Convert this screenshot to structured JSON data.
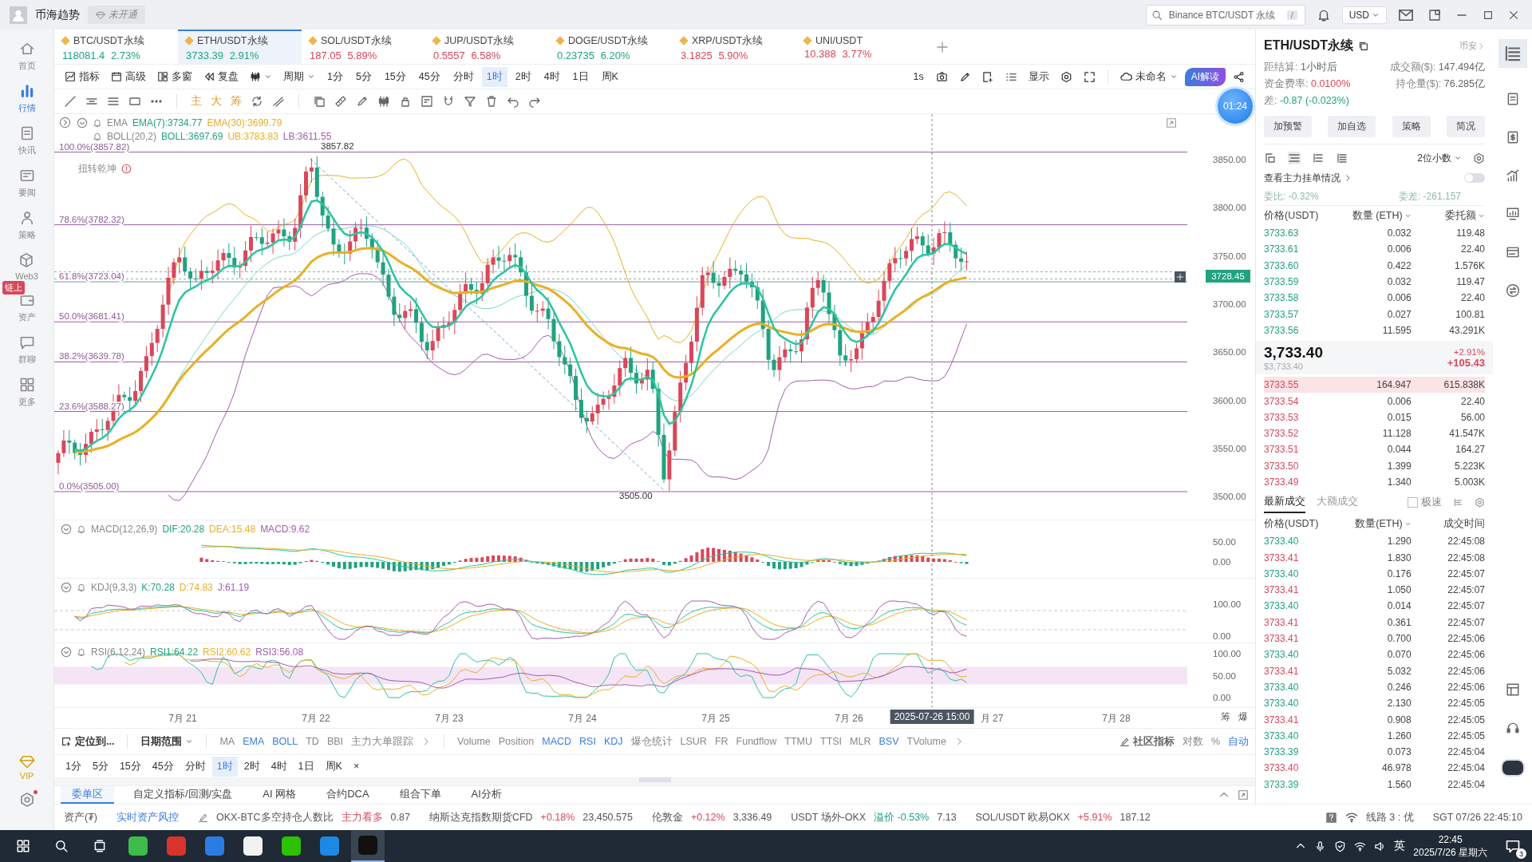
{
  "app_bar": {
    "title": "币海趋势",
    "badge": "未开通",
    "search": {
      "placeholder": "Binance BTC/USDT 永续",
      "shortcut": "/"
    },
    "currency": "USD"
  },
  "sidebar": {
    "items": [
      {
        "label": "首页",
        "selected": false
      },
      {
        "label": "行情",
        "selected": true
      },
      {
        "label": "快讯",
        "selected": false
      },
      {
        "label": "要闻",
        "selected": false
      },
      {
        "label": "策略",
        "selected": false
      },
      {
        "label": "Web3",
        "selected": false
      },
      {
        "label": "资产",
        "selected": false,
        "badge": "链上"
      },
      {
        "label": "群聊",
        "selected": false
      },
      {
        "label": "更多",
        "selected": false
      }
    ],
    "vip": "VIP"
  },
  "tickers": [
    {
      "symbol": "BTC/USDT永续",
      "price": "118081.4",
      "change": "2.73%",
      "color": "#20a27f",
      "selected": false
    },
    {
      "symbol": "ETH/USDT永续",
      "price": "3733.39",
      "change": "2.91%",
      "color": "#20a27f",
      "selected": true
    },
    {
      "symbol": "SOL/USDT永续",
      "price": "187.05",
      "change": "5.89%",
      "color": "#d9475a",
      "selected": false
    },
    {
      "symbol": "JUP/USDT永续",
      "price": "0.5557",
      "change": "6.58%",
      "color": "#d9475a",
      "selected": false
    },
    {
      "symbol": "DOGE/USDT永续",
      "price": "0.23735",
      "change": "6.20%",
      "color": "#20a27f",
      "selected": false
    },
    {
      "symbol": "XRP/USDT永续",
      "price": "3.1825",
      "change": "5.90%",
      "color": "#d9475a",
      "selected": false
    },
    {
      "symbol": "UNI/USDT",
      "price": "10.388",
      "change": "3.77%",
      "color": "#d9475a",
      "selected": false
    }
  ],
  "toolbar": {
    "tools": [
      "指标",
      "高级",
      "多窗",
      "复盘"
    ],
    "period_menu": "周期",
    "periods": [
      {
        "label": "1分",
        "selected": false
      },
      {
        "label": "5分",
        "selected": false
      },
      {
        "label": "15分",
        "selected": false
      },
      {
        "label": "45分",
        "selected": false
      },
      {
        "label": "分时",
        "selected": false
      },
      {
        "label": "1时",
        "selected": true
      },
      {
        "label": "2时",
        "selected": false
      },
      {
        "label": "4时",
        "selected": false
      },
      {
        "label": "1日",
        "selected": false
      },
      {
        "label": "周K",
        "selected": false
      }
    ],
    "interval": "1s",
    "display": "显示",
    "layout": "未命名",
    "ai": "AI解读"
  },
  "drawing_toolbar": {
    "text_tools": [
      "主",
      "大",
      "筹"
    ]
  },
  "chart": {
    "legend": {
      "ema": [
        "EMA",
        "EMA(7):3734.77",
        "EMA(30):3699.79"
      ],
      "boll": [
        "BOLL(20,2)",
        "BOLL:3697.69",
        "UB:3783.83",
        "LB:3611.55"
      ],
      "strategy": "扭转乾坤"
    },
    "fib_levels": [
      "100.0%(3857.82)",
      "78.6%(3782.32)",
      "61.8%(3723.04)",
      "50.0%(3681.41)",
      "38.2%(3639.78)",
      "23.6%(3588.27)",
      "0.0%(3505.00)"
    ],
    "high_marker": "3857.82",
    "low_marker": "3505.00",
    "price_ticks": [
      "3850.00",
      "3800.00",
      "3750.00",
      "3700.00",
      "3650.00",
      "3600.00",
      "3550.00",
      "3500.00"
    ],
    "price_tag": "3728.45",
    "macd": {
      "legend": [
        "MACD(12,26,9)",
        "DIF:20.28",
        "DEA:15.48",
        "MACD:9.62"
      ],
      "ticks": [
        "50.00",
        "0.00"
      ]
    },
    "kdj": {
      "legend": [
        "KDJ(9,3,3)",
        "K:70.28",
        "D:74.83",
        "J:61.19"
      ],
      "ticks": [
        "100.00",
        "0.00"
      ]
    },
    "rsi": {
      "legend": [
        "RSI(6,12,24)",
        "RSI1:64.22",
        "RSI2:60.62",
        "RSI3:56.08"
      ],
      "ticks": [
        "100.00",
        "50.00",
        "0.00"
      ]
    },
    "dates": [
      "7月 21",
      "7月 22",
      "7月 23",
      "7月 24",
      "7月 25",
      "7月 26",
      "月 27",
      "7月 28"
    ],
    "crosshair_time": "2025-07-26 15:00",
    "axis_tools": [
      "筹",
      "爆"
    ]
  },
  "indicator_bar": {
    "locate": "定位到...",
    "date_range": "日期范围",
    "main": [
      {
        "label": "MA",
        "on": false
      },
      {
        "label": "EMA",
        "on": true
      },
      {
        "label": "BOLL",
        "on": true
      },
      {
        "label": "TD",
        "on": false
      },
      {
        "label": "BBI",
        "on": false
      },
      {
        "label": "主力大单跟踪",
        "on": false
      }
    ],
    "sub": [
      {
        "label": "Volume",
        "on": false
      },
      {
        "label": "Position",
        "on": false
      },
      {
        "label": "MACD",
        "on": true
      },
      {
        "label": "RSI",
        "on": true
      },
      {
        "label": "KDJ",
        "on": true
      },
      {
        "label": "爆仓统计",
        "on": false
      },
      {
        "label": "LSUR",
        "on": false
      },
      {
        "label": "FR",
        "on": false
      },
      {
        "label": "Fundflow",
        "on": false
      },
      {
        "label": "TTMU",
        "on": false
      },
      {
        "label": "TTSI",
        "on": false
      },
      {
        "label": "MLR",
        "on": false
      },
      {
        "label": "BSV",
        "on": true
      },
      {
        "label": "TVolume",
        "on": false
      }
    ],
    "community": "社区指标",
    "scales": [
      {
        "label": "对数",
        "on": false
      },
      {
        "label": "%",
        "on": false
      },
      {
        "label": "自动",
        "on": true
      }
    ]
  },
  "period_bar": {
    "periods": [
      {
        "label": "1分",
        "selected": false
      },
      {
        "label": "5分",
        "selected": false
      },
      {
        "label": "15分",
        "selected": false
      },
      {
        "label": "45分",
        "selected": false
      },
      {
        "label": "分时",
        "selected": false
      },
      {
        "label": "1时",
        "selected": true
      },
      {
        "label": "2时",
        "selected": false
      },
      {
        "label": "4时",
        "selected": false
      },
      {
        "label": "1日",
        "selected": false
      },
      {
        "label": "周K",
        "selected": false
      }
    ],
    "close": "×"
  },
  "order_tabs": [
    {
      "label": "委单区",
      "selected": true
    },
    {
      "label": "自定义指标/回测/实盘",
      "selected": false
    },
    {
      "label": "AI 网格",
      "selected": false
    },
    {
      "label": "合约DCA",
      "selected": false
    },
    {
      "label": "组合下单",
      "selected": false
    },
    {
      "label": "AI分析",
      "selected": false
    }
  ],
  "status_bar": {
    "asset": "资产(₮)",
    "risk": "实时资产风控",
    "segments": [
      {
        "text": "OKX-BTC多空持仓人数比",
        "color": "#555555"
      },
      {
        "text": "主力看多",
        "color": "#d9475a"
      },
      {
        "text": "0.87",
        "color": "#555555"
      },
      {
        "text": "纳斯达克指数期货CFD",
        "color": "#555555"
      },
      {
        "text": "+0.18%",
        "color": "#d9475a"
      },
      {
        "text": "23,450.575",
        "color": "#555555"
      },
      {
        "text": "伦敦金",
        "color": "#555555"
      },
      {
        "text": "+0.12%",
        "color": "#d9475a"
      },
      {
        "text": "3,336.49",
        "color": "#555555"
      },
      {
        "text": "USDT 场外-OKX",
        "color": "#555555"
      },
      {
        "text": "溢价 -0.53%",
        "color": "#20a27f"
      },
      {
        "text": "7.13",
        "color": "#555555"
      },
      {
        "text": "SOL/USDT 欧易OKX",
        "color": "#555555"
      },
      {
        "text": "+5.91%",
        "color": "#d9475a"
      },
      {
        "text": "187.12",
        "color": "#555555"
      }
    ],
    "line": "线路 3 : 优",
    "clock": "SGT 07/26 22:45:10"
  },
  "market_panel": {
    "symbol": "ETH/USDT永续",
    "exchange": "币安",
    "stats": [
      {
        "label": "距结算:",
        "value": "1小时后",
        "color": "#666666"
      },
      {
        "label": "成交额($):",
        "value": "147.494亿",
        "color": "#666666"
      },
      {
        "label": "资金费率:",
        "value": "0.0100%",
        "color": "#d9475a"
      },
      {
        "label": "持仓量($):",
        "value": "76.285亿",
        "color": "#666666"
      },
      {
        "label": "差:",
        "value": "-0.87 (-0.023%)",
        "color": "#20a27f"
      }
    ],
    "buttons": [
      "加预警",
      "加自选",
      "策略",
      "简况"
    ],
    "precision": "2位小数",
    "main_orders": {
      "label": "查看主力挂单情况",
      "on": false
    },
    "ratios": [
      {
        "label": "委比:",
        "value": "-0.32%"
      },
      {
        "label": "委差:",
        "value": "-261.157"
      }
    ],
    "book_headers": [
      "价格(USDT)",
      "数量 (ETH)",
      "委托额"
    ],
    "asks": [
      {
        "price": "3733.63",
        "amount": "0.032",
        "total": "119.48"
      },
      {
        "price": "3733.61",
        "amount": "0.006",
        "total": "22.40"
      },
      {
        "price": "3733.60",
        "amount": "0.422",
        "total": "1.576K"
      },
      {
        "price": "3733.59",
        "amount": "0.032",
        "total": "119.47"
      },
      {
        "price": "3733.58",
        "amount": "0.006",
        "total": "22.40"
      },
      {
        "price": "3733.57",
        "amount": "0.027",
        "total": "100.81"
      },
      {
        "price": "3733.56",
        "amount": "11.595",
        "total": "43.291K"
      }
    ],
    "mid": {
      "price": "3,733.40",
      "usd": "$3,733.40",
      "change_pct": "+2.91%",
      "change": "+105.43"
    },
    "bids": [
      {
        "price": "3733.55",
        "amount": "164.947",
        "total": "615.838K",
        "highlighted": true
      },
      {
        "price": "3733.54",
        "amount": "0.006",
        "total": "22.40",
        "highlighted": false
      },
      {
        "price": "3733.53",
        "amount": "0.015",
        "total": "56.00",
        "highlighted": false
      },
      {
        "price": "3733.52",
        "amount": "11.128",
        "total": "41.547K",
        "highlighted": false
      },
      {
        "price": "3733.51",
        "amount": "0.044",
        "total": "164.27",
        "highlighted": false
      },
      {
        "price": "3733.50",
        "amount": "1.399",
        "total": "5.223K",
        "highlighted": false
      },
      {
        "price": "3733.49",
        "amount": "1.340",
        "total": "5.003K",
        "highlighted": false
      }
    ],
    "trade_tabs": [
      {
        "label": "最新成交",
        "selected": true
      },
      {
        "label": "大额成交",
        "selected": false
      }
    ],
    "fast": {
      "label": "极速",
      "checked": false
    },
    "trade_headers": [
      "价格(USDT)",
      "数量(ETH)",
      "成交时间"
    ],
    "trades": [
      {
        "price": "3733.40",
        "amount": "1.290",
        "time": "22:45:08",
        "color": "#20a27f"
      },
      {
        "price": "3733.41",
        "amount": "1.830",
        "time": "22:45:08",
        "color": "#d9475a"
      },
      {
        "price": "3733.40",
        "amount": "0.176",
        "time": "22:45:07",
        "color": "#20a27f"
      },
      {
        "price": "3733.41",
        "amount": "1.050",
        "time": "22:45:07",
        "color": "#d9475a"
      },
      {
        "price": "3733.40",
        "amount": "0.014",
        "time": "22:45:07",
        "color": "#20a27f"
      },
      {
        "price": "3733.41",
        "amount": "0.361",
        "time": "22:45:07",
        "color": "#d9475a"
      },
      {
        "price": "3733.41",
        "amount": "0.700",
        "time": "22:45:06",
        "color": "#d9475a"
      },
      {
        "price": "3733.40",
        "amount": "0.070",
        "time": "22:45:06",
        "color": "#20a27f"
      },
      {
        "price": "3733.41",
        "amount": "5.032",
        "time": "22:45:06",
        "color": "#d9475a"
      },
      {
        "price": "3733.40",
        "amount": "0.246",
        "time": "22:45:06",
        "color": "#20a27f"
      },
      {
        "price": "3733.40",
        "amount": "2.130",
        "time": "22:45:05",
        "color": "#20a27f"
      },
      {
        "price": "3733.41",
        "amount": "0.908",
        "time": "22:45:05",
        "color": "#d9475a"
      },
      {
        "price": "3733.40",
        "amount": "1.260",
        "time": "22:45:05",
        "color": "#20a27f"
      },
      {
        "price": "3733.39",
        "amount": "0.073",
        "time": "22:45:04",
        "color": "#20a27f"
      },
      {
        "price": "3733.40",
        "amount": "46.978",
        "time": "22:45:04",
        "color": "#d9475a"
      },
      {
        "price": "3733.39",
        "amount": "1.560",
        "time": "22:45:04",
        "color": "#20a27f"
      }
    ]
  },
  "timer": "01:24",
  "taskbar": {
    "ime": "英",
    "time": "22:45",
    "date": "2025/7/26 星期六",
    "notifications": "3"
  }
}
